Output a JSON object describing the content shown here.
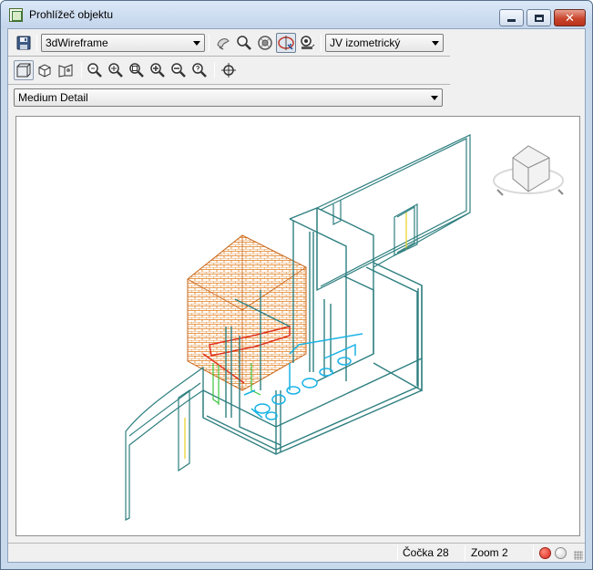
{
  "window": {
    "title": "Prohlížeč objektu"
  },
  "toolbar": {
    "visual_style": {
      "selected": "3dWireframe"
    },
    "view": {
      "selected": "JV izometrický"
    },
    "detail": {
      "selected": "Medium Detail"
    }
  },
  "status": {
    "lens": "Čočka 28",
    "zoom": "Zoom 2"
  },
  "icons": [
    "save-icon",
    "visual-style-icon",
    "zoom-icon",
    "orbit-icon",
    "free-orbit-icon",
    "camera-icon",
    "box-view-icon",
    "cube-view-icon",
    "perspective-icon",
    "zoom-realtime-icon",
    "zoom-in-icon",
    "zoom-window-icon",
    "zoom-plus-icon",
    "zoom-minus-icon",
    "zoom-extents-icon",
    "target-icon",
    "viewcube-icon"
  ],
  "colors": {
    "wire_teal": "#2f7f80",
    "wire_cyan": "#1ab3e6",
    "brick_orange": "#e07b1a",
    "wire_red": "#e0301e",
    "wire_green": "#3cc43c",
    "yellow": "#e6d21e"
  }
}
